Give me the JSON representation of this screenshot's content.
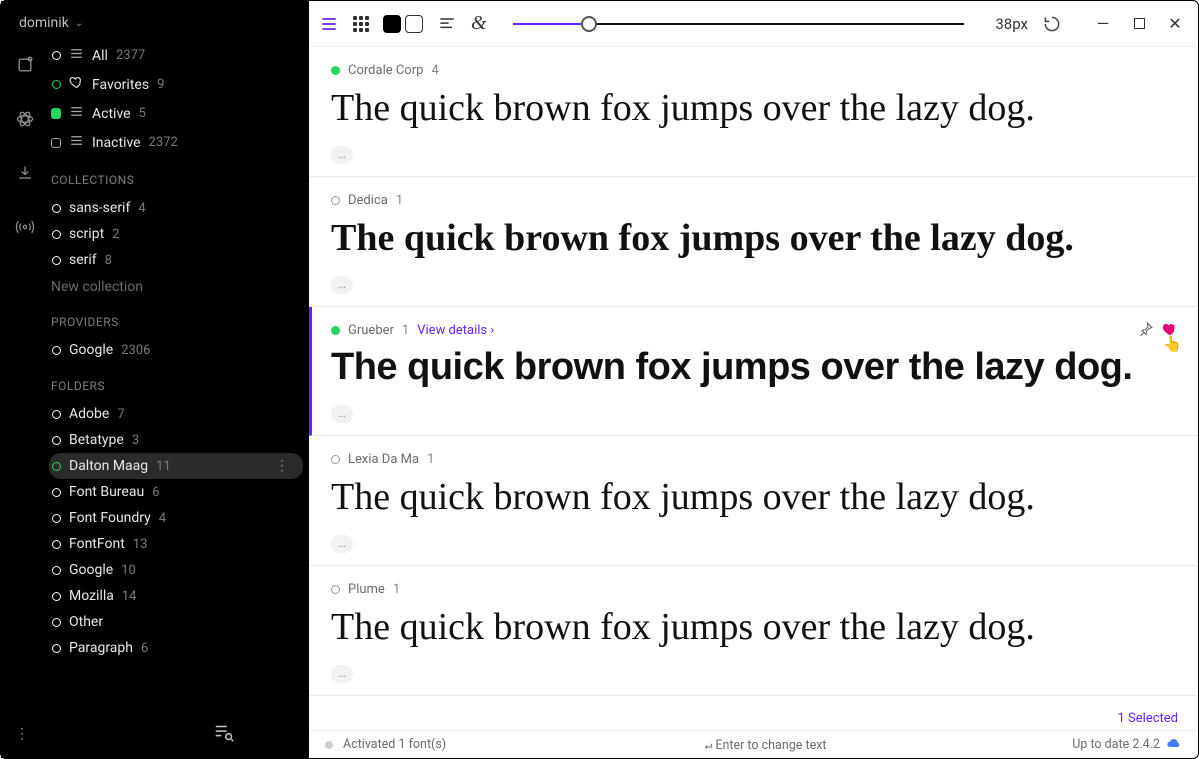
{
  "user": {
    "name": "dominik"
  },
  "sidebar": {
    "filters": {
      "all": {
        "label": "All",
        "count": "2377"
      },
      "favorites": {
        "label": "Favorites",
        "count": "9"
      },
      "active": {
        "label": "Active",
        "count": "5"
      },
      "inactive": {
        "label": "Inactive",
        "count": "2372"
      }
    },
    "collections_header": "COLLECTIONS",
    "collections": [
      {
        "label": "sans-serif",
        "count": "4"
      },
      {
        "label": "script",
        "count": "2"
      },
      {
        "label": "serif",
        "count": "8"
      }
    ],
    "new_collection": "New collection",
    "providers_header": "PROVIDERS",
    "providers": [
      {
        "label": "Google",
        "count": "2306"
      }
    ],
    "folders_header": "FOLDERS",
    "folders": [
      {
        "label": "Adobe",
        "count": "7"
      },
      {
        "label": "Betatype",
        "count": "3"
      },
      {
        "label": "Dalton Maag",
        "count": "11",
        "selected": true
      },
      {
        "label": "Font Bureau",
        "count": "6"
      },
      {
        "label": "Font Foundry",
        "count": "4"
      },
      {
        "label": "FontFont",
        "count": "13"
      },
      {
        "label": "Google",
        "count": "10"
      },
      {
        "label": "Mozilla",
        "count": "14"
      },
      {
        "label": "Other",
        "count": ""
      },
      {
        "label": "Paragraph",
        "count": "6"
      }
    ]
  },
  "toolbar": {
    "size_label": "38px"
  },
  "sample_text": "The quick brown fox jumps over the lazy dog.",
  "fonts": [
    {
      "name": "Cordale Corp",
      "count": "4",
      "active": true,
      "style_class": "f-cordale"
    },
    {
      "name": "Dedica",
      "count": "1",
      "active": false,
      "style_class": "f-dedica"
    },
    {
      "name": "Grueber",
      "count": "1",
      "active": true,
      "style_class": "f-grueber",
      "selected": true,
      "details": "View details ›",
      "favorited": true
    },
    {
      "name": "Lexia Da Ma",
      "count": "1",
      "active": false,
      "style_class": "f-lexia"
    },
    {
      "name": "Plume",
      "count": "1",
      "active": false,
      "style_class": "f-plume"
    }
  ],
  "selected_label": "1 Selected",
  "status": {
    "left": "Activated 1 font(s)",
    "center": "Enter to change text",
    "right": "Up to date 2.4.2"
  }
}
